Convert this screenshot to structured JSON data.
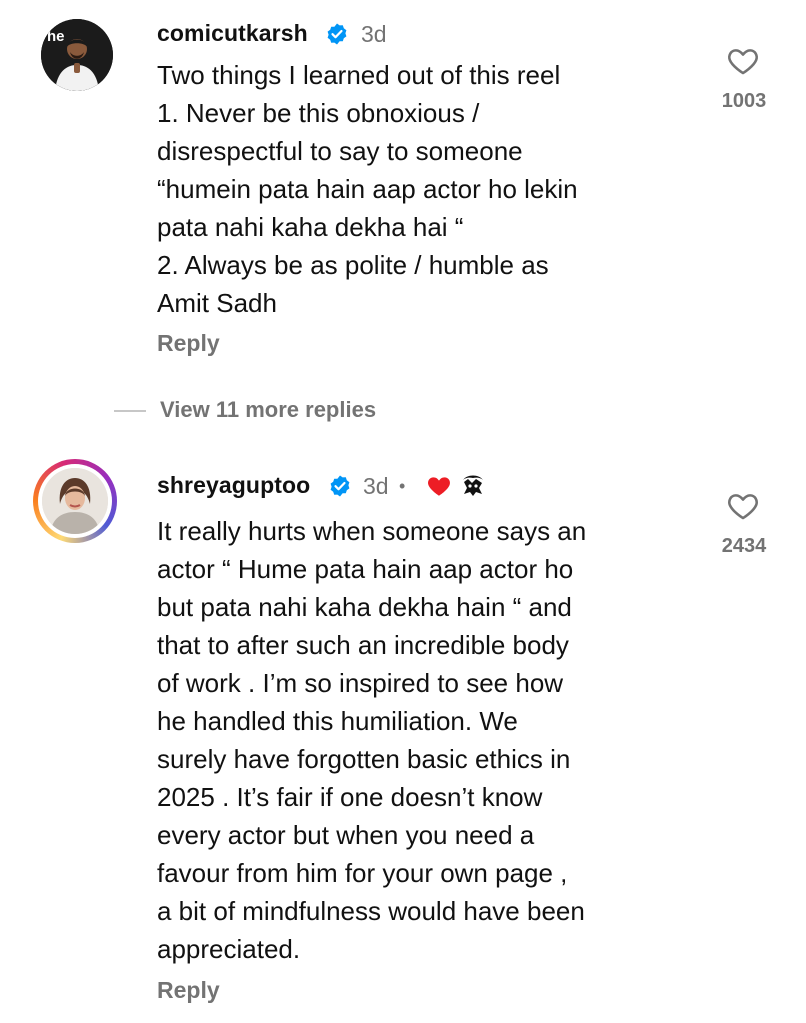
{
  "comments": [
    {
      "username": "comicutkarsh",
      "time": "3d",
      "avatar_text": "he",
      "body": "Two things I learned out of this reel\n1. Never be this obnoxious /\ndisrespectful to say to someone\n“humein pata hain aap actor ho lekin\npata nahi kaha dekha hai “\n2. Always be as polite / humble as\nAmit Sadh",
      "reply_label": "Reply",
      "likes": "1003",
      "view_more": "View 11 more replies"
    },
    {
      "username": "shreyaguptoo",
      "time": "3d",
      "separator": "•",
      "body": "It really hurts when someone says an\nactor “ Hume pata hain aap actor ho\nbut pata nahi kaha dekha hain “ and\nthat to after such an incredible body\nof work . I’m so inspired to see how\nhe handled this humiliation. We\nsurely have forgotten basic ethics in\n2025 . It’s fair if one doesn’t know\nevery actor but when you need a\nfavour from him for your own page ,\na bit of mindfulness would have been\nappreciated.",
      "reply_label": "Reply",
      "likes": "2434"
    }
  ],
  "colors": {
    "verified_blue": "#0095f6",
    "secondary_text": "#737373",
    "heart_red": "#ed1d25"
  }
}
